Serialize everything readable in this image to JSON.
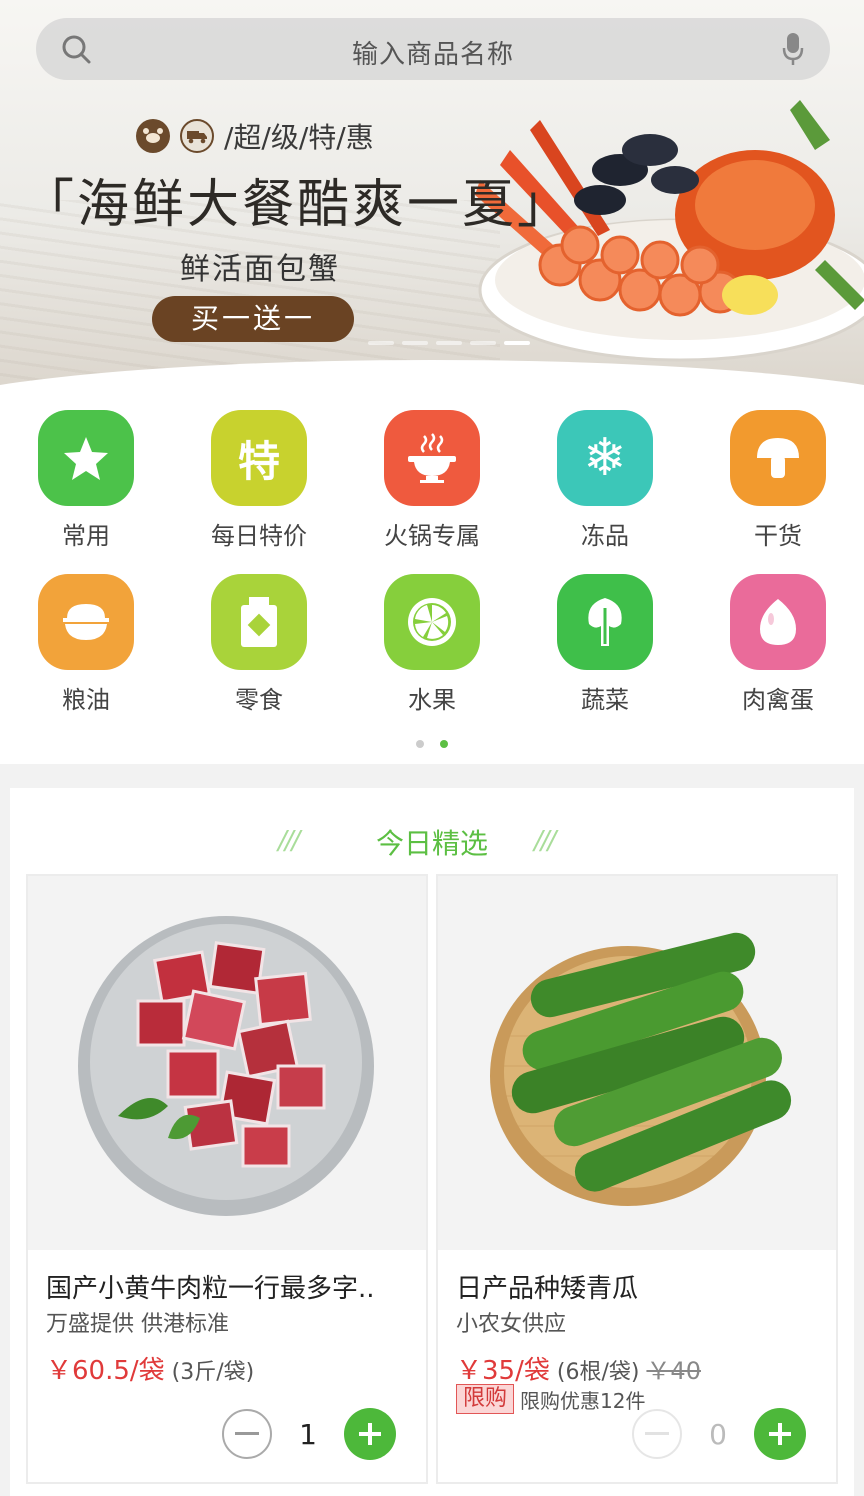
{
  "search": {
    "placeholder": "输入商品名称",
    "search_icon": "search-icon",
    "mic_icon": "microphone-icon"
  },
  "banner": {
    "tag_text": "/超/级/特/惠",
    "title": "「海鲜大餐酷爽一夏」",
    "subtitle": "鲜活面包蟹",
    "button_label": "买一送一",
    "slide_count": 5,
    "active_slide": 5
  },
  "categories": [
    {
      "label": "常用",
      "icon": "star-icon",
      "color": "#4cc24a"
    },
    {
      "label": "每日特价",
      "icon": "special-offer-icon",
      "color": "#c8d22e",
      "glyph": "特"
    },
    {
      "label": "火锅专属",
      "icon": "hotpot-icon",
      "color": "#ef5a3e"
    },
    {
      "label": "冻品",
      "icon": "snowflake-icon",
      "color": "#3cc7b8"
    },
    {
      "label": "干货",
      "icon": "mushroom-icon",
      "color": "#f29a2e"
    },
    {
      "label": "粮油",
      "icon": "rice-bowl-icon",
      "color": "#f2a33a"
    },
    {
      "label": "零食",
      "icon": "snack-jar-icon",
      "color": "#a9d33a"
    },
    {
      "label": "水果",
      "icon": "lime-slice-icon",
      "color": "#86cf3c"
    },
    {
      "label": "蔬菜",
      "icon": "bok-choy-icon",
      "color": "#3fbf4a"
    },
    {
      "label": "肉禽蛋",
      "icon": "egg-icon",
      "color": "#ea6b9a"
    }
  ],
  "category_pager": {
    "pages": 2,
    "active": 2
  },
  "section": {
    "title": "今日精选",
    "deco": "///"
  },
  "products": [
    {
      "name": "国产小黄牛肉粒一行最多字..",
      "supplier": "万盛提供 供港标准",
      "price": "￥60.5/袋",
      "spec": "(3斤/袋)",
      "quantity": "1",
      "image": "beef-cubes-image"
    },
    {
      "name": "日产品种矮青瓜",
      "supplier": "小农女供应",
      "price": "￥35/袋",
      "spec": "(6根/袋)",
      "old_price": "￥40",
      "limit_tag": "限购",
      "limit_text": "限购优惠12件",
      "quantity": "0",
      "image": "cucumbers-image"
    }
  ]
}
